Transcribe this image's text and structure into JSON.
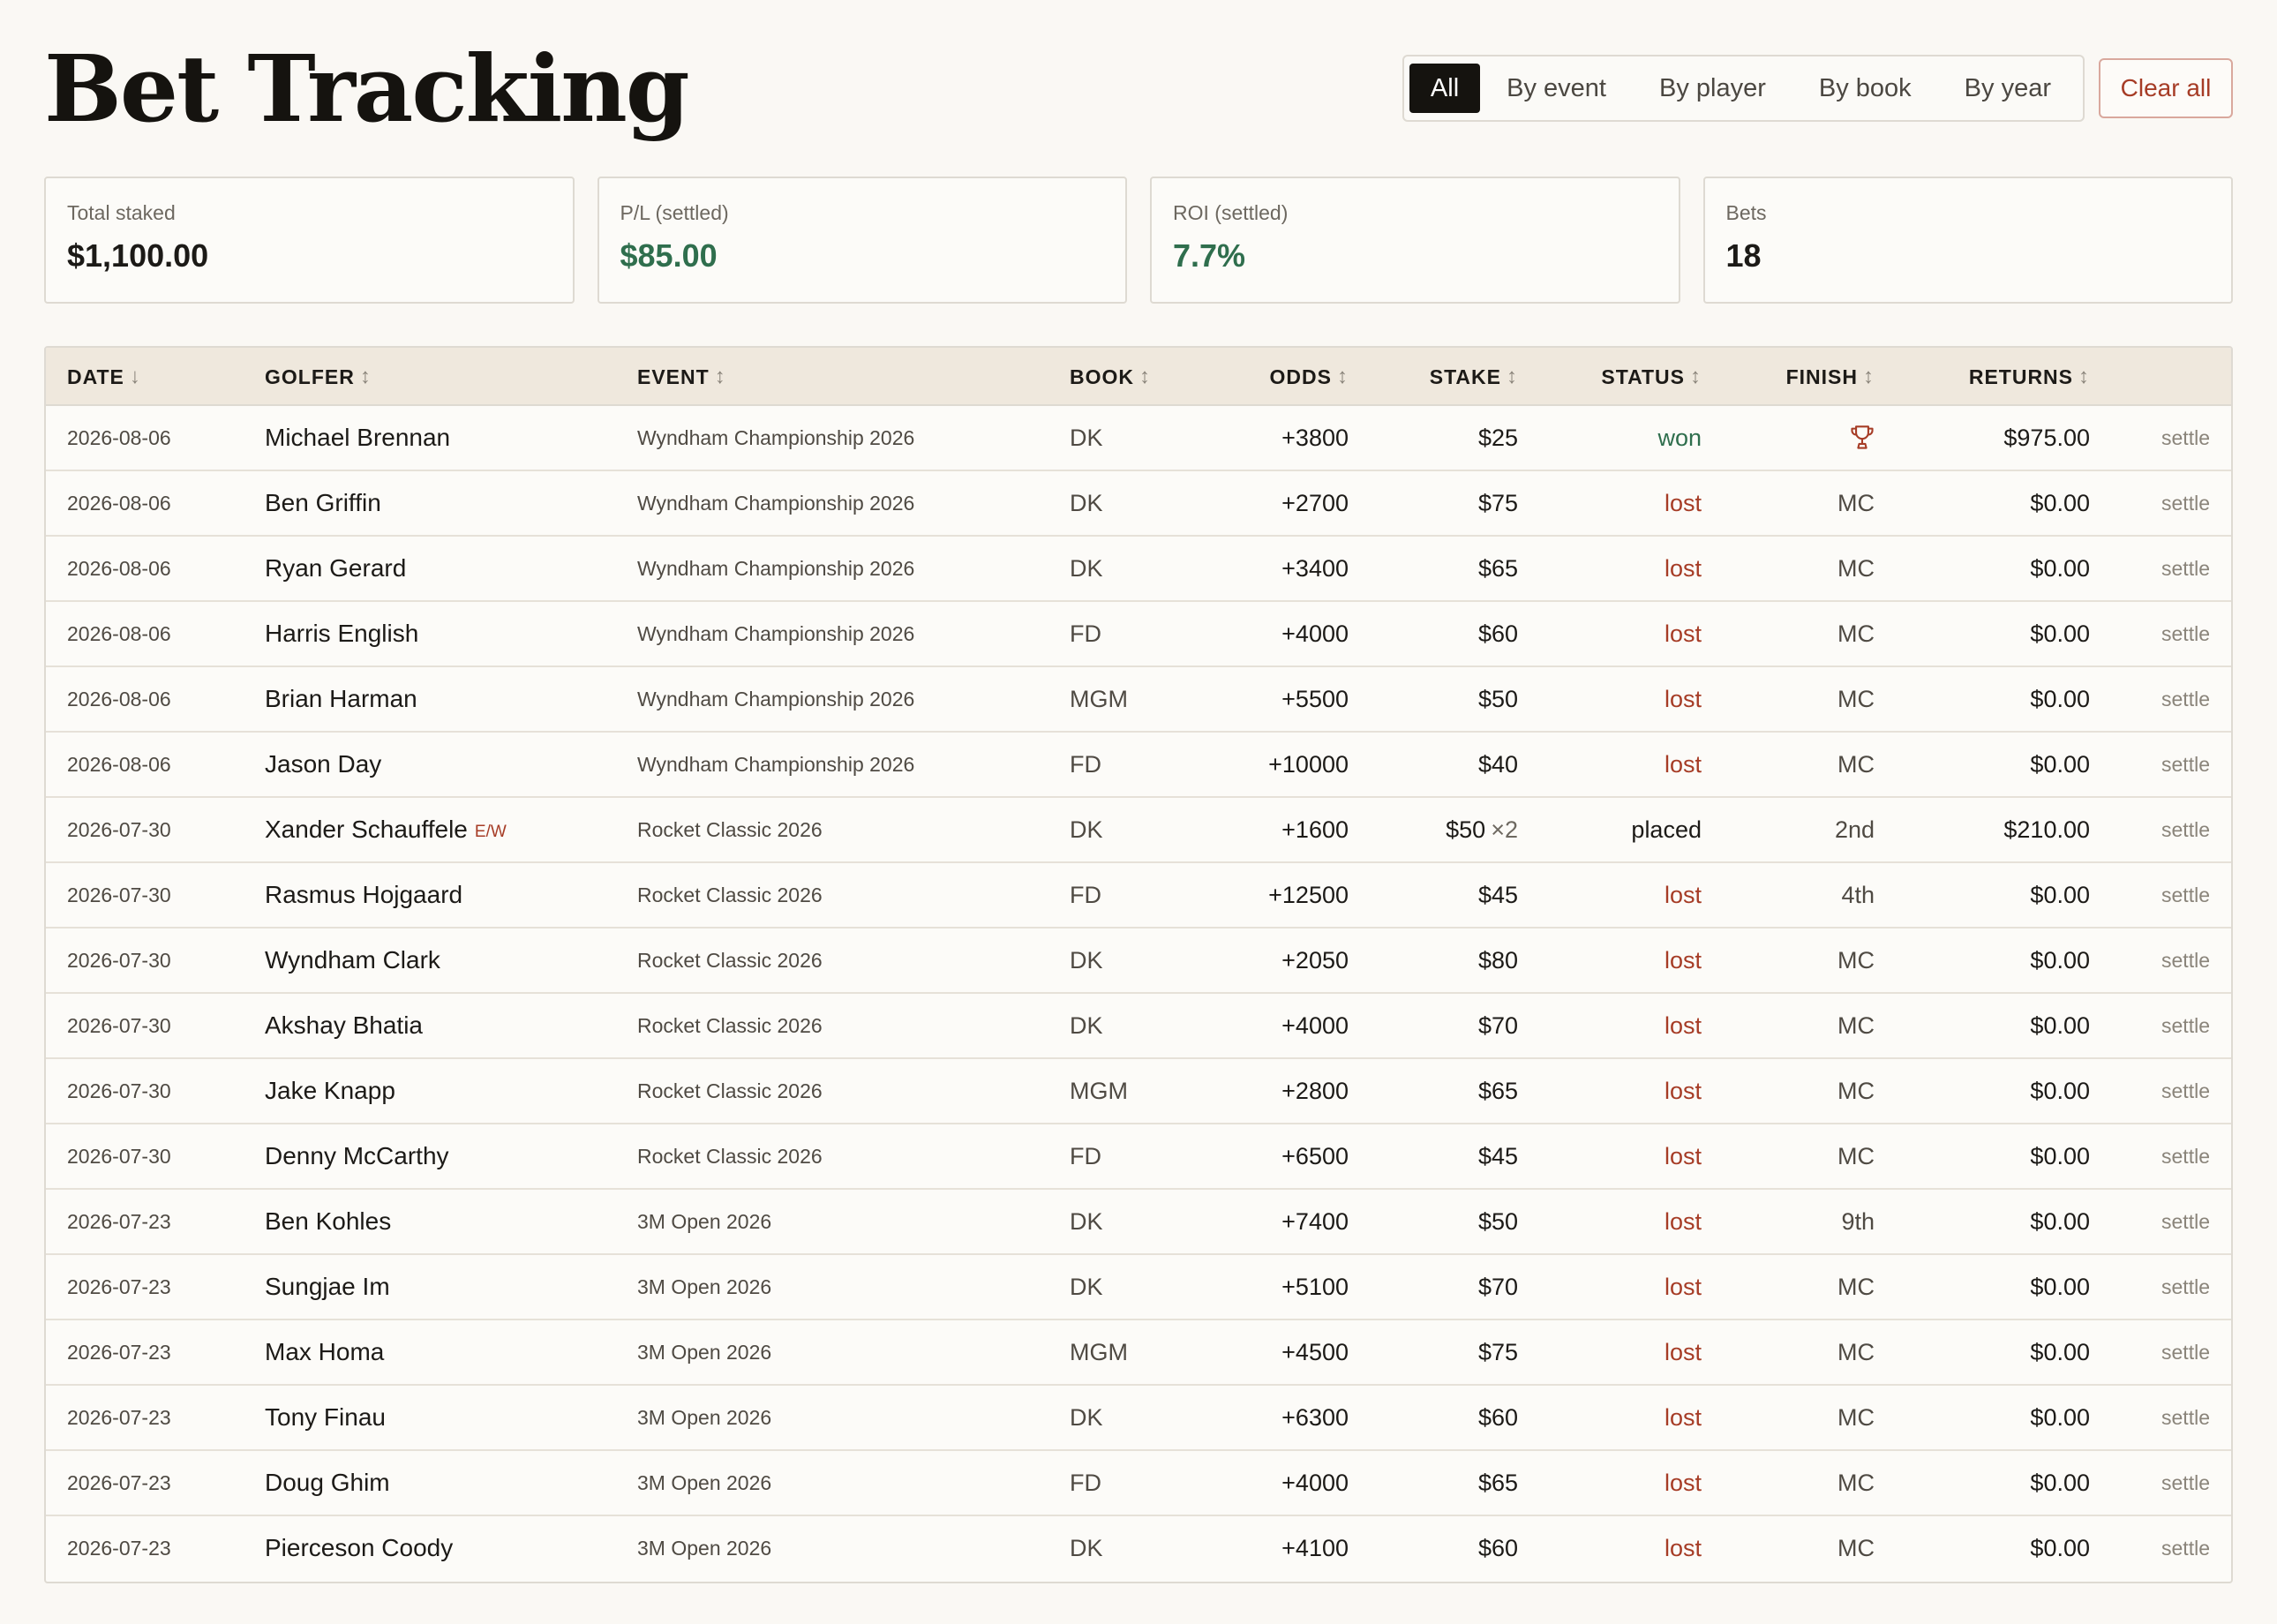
{
  "header": {
    "title": "Bet Tracking",
    "tabs": [
      {
        "label": "All",
        "active": true
      },
      {
        "label": "By event",
        "active": false
      },
      {
        "label": "By player",
        "active": false
      },
      {
        "label": "By book",
        "active": false
      },
      {
        "label": "By year",
        "active": false
      }
    ],
    "clear_label": "Clear all"
  },
  "stats": [
    {
      "label": "Total staked",
      "value": "$1,100.00",
      "color": "#1c1a17"
    },
    {
      "label": "P/L (settled)",
      "value": "$85.00",
      "color": "#2f6e4d"
    },
    {
      "label": "ROI (settled)",
      "value": "7.7%",
      "color": "#2f6e4d"
    },
    {
      "label": "Bets",
      "value": "18",
      "color": "#1c1a17"
    }
  ],
  "table": {
    "columns": [
      {
        "key": "date",
        "label": "DATE",
        "sort": "↓"
      },
      {
        "key": "golfer",
        "label": "GOLFER",
        "sort": "↕"
      },
      {
        "key": "event",
        "label": "EVENT",
        "sort": "↕"
      },
      {
        "key": "book",
        "label": "BOOK",
        "sort": "↕"
      },
      {
        "key": "odds",
        "label": "ODDS",
        "sort": "↕"
      },
      {
        "key": "stake",
        "label": "STAKE",
        "sort": "↕"
      },
      {
        "key": "status",
        "label": "STATUS",
        "sort": "↕"
      },
      {
        "key": "finish",
        "label": "FINISH",
        "sort": "↕"
      },
      {
        "key": "returns",
        "label": "RETURNS",
        "sort": "↕"
      }
    ],
    "settle_label": "settle",
    "rows": [
      {
        "date": "2026-08-06",
        "golfer": "Michael Brennan",
        "ew": "",
        "event": "Wyndham Championship 2026",
        "book": "DK",
        "odds": "+3800",
        "stake": "$25",
        "mult": "",
        "status": "won",
        "finish": "",
        "finish_icon": "trophy-icon",
        "returns": "$975.00"
      },
      {
        "date": "2026-08-06",
        "golfer": "Ben Griffin",
        "ew": "",
        "event": "Wyndham Championship 2026",
        "book": "DK",
        "odds": "+2700",
        "stake": "$75",
        "mult": "",
        "status": "lost",
        "finish": "MC",
        "finish_icon": "",
        "returns": "$0.00"
      },
      {
        "date": "2026-08-06",
        "golfer": "Ryan Gerard",
        "ew": "",
        "event": "Wyndham Championship 2026",
        "book": "DK",
        "odds": "+3400",
        "stake": "$65",
        "mult": "",
        "status": "lost",
        "finish": "MC",
        "finish_icon": "",
        "returns": "$0.00"
      },
      {
        "date": "2026-08-06",
        "golfer": "Harris English",
        "ew": "",
        "event": "Wyndham Championship 2026",
        "book": "FD",
        "odds": "+4000",
        "stake": "$60",
        "mult": "",
        "status": "lost",
        "finish": "MC",
        "finish_icon": "",
        "returns": "$0.00"
      },
      {
        "date": "2026-08-06",
        "golfer": "Brian Harman",
        "ew": "",
        "event": "Wyndham Championship 2026",
        "book": "MGM",
        "odds": "+5500",
        "stake": "$50",
        "mult": "",
        "status": "lost",
        "finish": "MC",
        "finish_icon": "",
        "returns": "$0.00"
      },
      {
        "date": "2026-08-06",
        "golfer": "Jason Day",
        "ew": "",
        "event": "Wyndham Championship 2026",
        "book": "FD",
        "odds": "+10000",
        "stake": "$40",
        "mult": "",
        "status": "lost",
        "finish": "MC",
        "finish_icon": "",
        "returns": "$0.00"
      },
      {
        "date": "2026-07-30",
        "golfer": "Xander Schauffele",
        "ew": "E/W",
        "event": "Rocket Classic 2026",
        "book": "DK",
        "odds": "+1600",
        "stake": "$50",
        "mult": "×2",
        "status": "placed",
        "finish": "2nd",
        "finish_icon": "",
        "returns": "$210.00"
      },
      {
        "date": "2026-07-30",
        "golfer": "Rasmus Hojgaard",
        "ew": "",
        "event": "Rocket Classic 2026",
        "book": "FD",
        "odds": "+12500",
        "stake": "$45",
        "mult": "",
        "status": "lost",
        "finish": "4th",
        "finish_icon": "",
        "returns": "$0.00"
      },
      {
        "date": "2026-07-30",
        "golfer": "Wyndham Clark",
        "ew": "",
        "event": "Rocket Classic 2026",
        "book": "DK",
        "odds": "+2050",
        "stake": "$80",
        "mult": "",
        "status": "lost",
        "finish": "MC",
        "finish_icon": "",
        "returns": "$0.00"
      },
      {
        "date": "2026-07-30",
        "golfer": "Akshay Bhatia",
        "ew": "",
        "event": "Rocket Classic 2026",
        "book": "DK",
        "odds": "+4000",
        "stake": "$70",
        "mult": "",
        "status": "lost",
        "finish": "MC",
        "finish_icon": "",
        "returns": "$0.00"
      },
      {
        "date": "2026-07-30",
        "golfer": "Jake Knapp",
        "ew": "",
        "event": "Rocket Classic 2026",
        "book": "MGM",
        "odds": "+2800",
        "stake": "$65",
        "mult": "",
        "status": "lost",
        "finish": "MC",
        "finish_icon": "",
        "returns": "$0.00"
      },
      {
        "date": "2026-07-30",
        "golfer": "Denny McCarthy",
        "ew": "",
        "event": "Rocket Classic 2026",
        "book": "FD",
        "odds": "+6500",
        "stake": "$45",
        "mult": "",
        "status": "lost",
        "finish": "MC",
        "finish_icon": "",
        "returns": "$0.00"
      },
      {
        "date": "2026-07-23",
        "golfer": "Ben Kohles",
        "ew": "",
        "event": "3M Open 2026",
        "book": "DK",
        "odds": "+7400",
        "stake": "$50",
        "mult": "",
        "status": "lost",
        "finish": "9th",
        "finish_icon": "",
        "returns": "$0.00"
      },
      {
        "date": "2026-07-23",
        "golfer": "Sungjae Im",
        "ew": "",
        "event": "3M Open 2026",
        "book": "DK",
        "odds": "+5100",
        "stake": "$70",
        "mult": "",
        "status": "lost",
        "finish": "MC",
        "finish_icon": "",
        "returns": "$0.00"
      },
      {
        "date": "2026-07-23",
        "golfer": "Max Homa",
        "ew": "",
        "event": "3M Open 2026",
        "book": "MGM",
        "odds": "+4500",
        "stake": "$75",
        "mult": "",
        "status": "lost",
        "finish": "MC",
        "finish_icon": "",
        "returns": "$0.00"
      },
      {
        "date": "2026-07-23",
        "golfer": "Tony Finau",
        "ew": "",
        "event": "3M Open 2026",
        "book": "DK",
        "odds": "+6300",
        "stake": "$60",
        "mult": "",
        "status": "lost",
        "finish": "MC",
        "finish_icon": "",
        "returns": "$0.00"
      },
      {
        "date": "2026-07-23",
        "golfer": "Doug Ghim",
        "ew": "",
        "event": "3M Open 2026",
        "book": "FD",
        "odds": "+4000",
        "stake": "$65",
        "mult": "",
        "status": "lost",
        "finish": "MC",
        "finish_icon": "",
        "returns": "$0.00"
      },
      {
        "date": "2026-07-23",
        "golfer": "Pierceson Coody",
        "ew": "",
        "event": "3M Open 2026",
        "book": "DK",
        "odds": "+4100",
        "stake": "$60",
        "mult": "",
        "status": "lost",
        "finish": "MC",
        "finish_icon": "",
        "returns": "$0.00"
      }
    ]
  },
  "colors": {
    "accent_green": "#2f6e4d",
    "accent_red": "#a63c26",
    "header_bg": "#efe8dd",
    "tab_active_bg": "#15130f"
  }
}
